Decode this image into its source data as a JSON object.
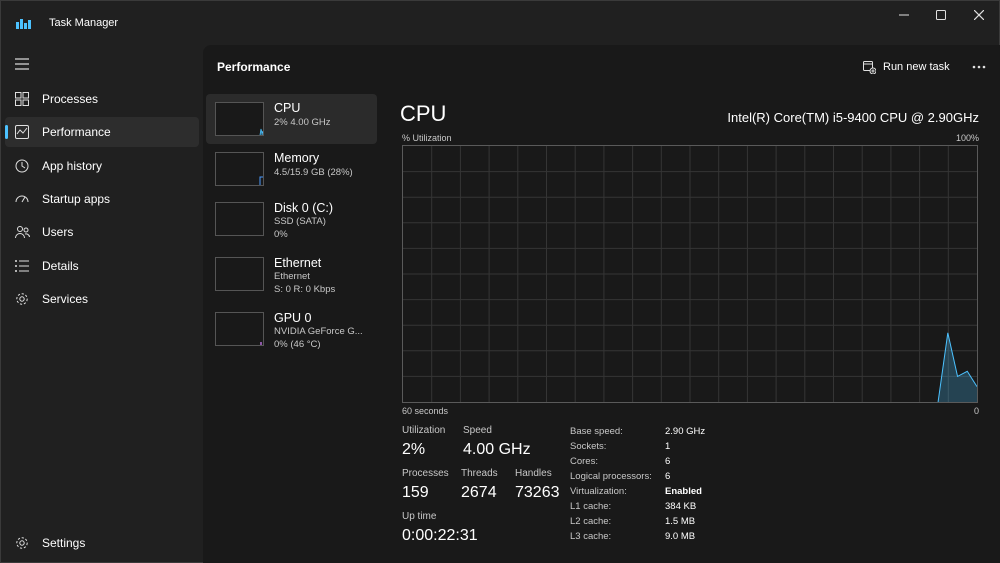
{
  "window": {
    "title": "Task Manager"
  },
  "nav": {
    "items": [
      {
        "label": "Processes",
        "icon": "processes-icon"
      },
      {
        "label": "Performance",
        "icon": "performance-icon",
        "active": true
      },
      {
        "label": "App history",
        "icon": "app-history-icon"
      },
      {
        "label": "Startup apps",
        "icon": "startup-apps-icon"
      },
      {
        "label": "Users",
        "icon": "users-icon"
      },
      {
        "label": "Details",
        "icon": "details-icon"
      },
      {
        "label": "Services",
        "icon": "services-icon"
      }
    ],
    "settings": {
      "label": "Settings",
      "icon": "settings-icon"
    }
  },
  "header": {
    "title": "Performance",
    "run_task_label": "Run new task"
  },
  "devices": [
    {
      "name": "CPU",
      "lines": [
        "2%  4.00 GHz"
      ],
      "color": "#4cc2ff",
      "active": true
    },
    {
      "name": "Memory",
      "lines": [
        "4.5/15.9 GB (28%)"
      ],
      "color": "#4c9cff"
    },
    {
      "name": "Disk 0 (C:)",
      "lines": [
        "SSD (SATA)",
        "0%"
      ],
      "color": "#7fd35a"
    },
    {
      "name": "Ethernet",
      "lines": [
        "Ethernet",
        "S: 0 R: 0 Kbps"
      ],
      "color": "#c47a3a"
    },
    {
      "name": "GPU 0",
      "lines": [
        "NVIDIA GeForce G...",
        "0%  (46 °C)"
      ],
      "color": "#b36bd6"
    }
  ],
  "detail": {
    "title": "CPU",
    "model": "Intel(R) Core(TM) i5-9400 CPU @ 2.90GHz",
    "graph_label": "% Utilization",
    "graph_max": "100%",
    "graph_time": "60 seconds",
    "graph_min": "0",
    "graph_color": "#4cc2ff",
    "utilization_history": [
      0,
      0,
      0,
      0,
      0,
      0,
      0,
      0,
      0,
      0,
      0,
      0,
      0,
      0,
      0,
      0,
      0,
      0,
      0,
      0,
      0,
      0,
      0,
      0,
      0,
      0,
      0,
      0,
      0,
      0,
      0,
      0,
      0,
      0,
      0,
      0,
      0,
      0,
      0,
      0,
      0,
      0,
      0,
      0,
      0,
      0,
      0,
      0,
      0,
      0,
      0,
      0,
      0,
      0,
      0,
      0,
      27,
      10,
      12,
      6
    ]
  },
  "stats": {
    "utilization": {
      "label": "Utilization",
      "value": "2%"
    },
    "speed": {
      "label": "Speed",
      "value": "4.00 GHz"
    },
    "processes": {
      "label": "Processes",
      "value": "159"
    },
    "threads": {
      "label": "Threads",
      "value": "2674"
    },
    "handles": {
      "label": "Handles",
      "value": "73263"
    },
    "uptime": {
      "label": "Up time",
      "value": "0:00:22:31"
    }
  },
  "specs": [
    {
      "label": "Base speed:",
      "value": "2.90 GHz"
    },
    {
      "label": "Sockets:",
      "value": "1"
    },
    {
      "label": "Cores:",
      "value": "6"
    },
    {
      "label": "Logical processors:",
      "value": "6"
    },
    {
      "label": "Virtualization:",
      "value": "Enabled"
    },
    {
      "label": "L1 cache:",
      "value": "384 KB"
    },
    {
      "label": "L2 cache:",
      "value": "1.5 MB"
    },
    {
      "label": "L3 cache:",
      "value": "9.0 MB"
    }
  ]
}
